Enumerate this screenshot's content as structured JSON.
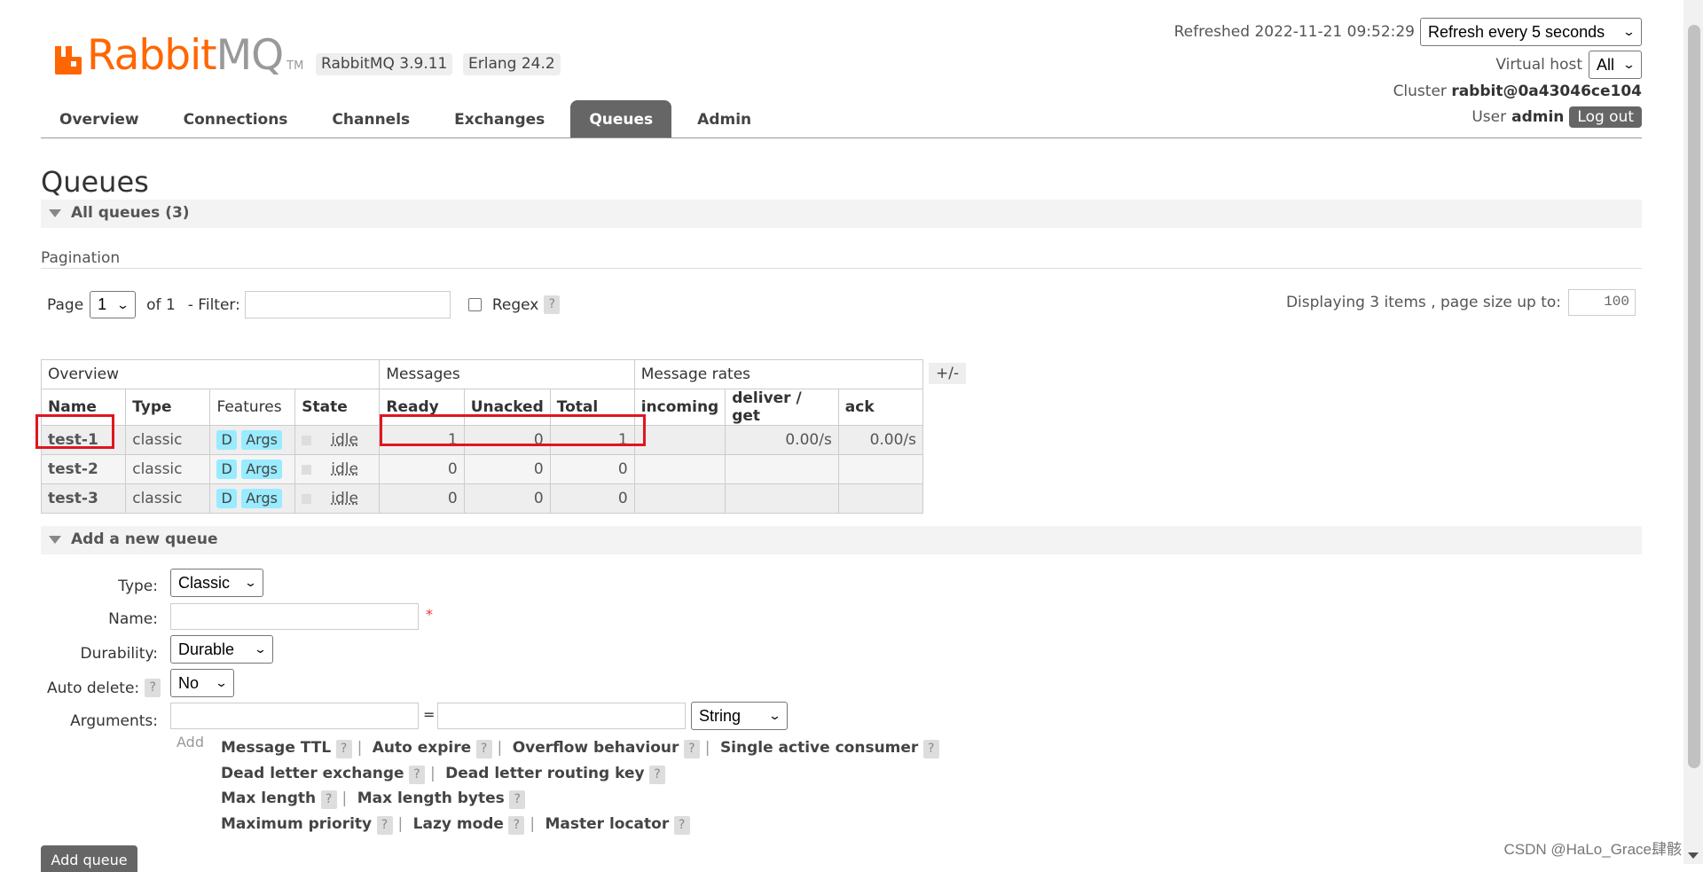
{
  "app": {
    "logo_text_rabbit": "Rabbit",
    "logo_text_mq": "MQ",
    "logo_tm": "TM",
    "version": "RabbitMQ 3.9.11",
    "erlang": "Erlang 24.2"
  },
  "header": {
    "refreshed": "Refreshed 2022-11-21 09:52:29",
    "refresh_select": "Refresh every 5 seconds",
    "vhost_label": "Virtual host",
    "vhost_select": "All",
    "cluster_label": "Cluster",
    "cluster_value": "rabbit@0a43046ce104",
    "user_label": "User",
    "user_value": "admin",
    "logout": "Log out"
  },
  "nav": [
    "Overview",
    "Connections",
    "Channels",
    "Exchanges",
    "Queues",
    "Admin"
  ],
  "page_title": "Queues",
  "all_queues": "All queues (3)",
  "pagination": {
    "label": "Pagination",
    "page_label": "Page",
    "page_value": "1",
    "of_label": "of 1",
    "filter_label": "- Filter:",
    "regex_label": "Regex",
    "help": "?",
    "displaying": "Displaying 3 items , page size up to:",
    "page_size": "100"
  },
  "table": {
    "group_overview": "Overview",
    "group_messages": "Messages",
    "group_rates": "Message rates",
    "toggle": "+/-",
    "headers": [
      "Name",
      "Type",
      "Features",
      "State",
      "Ready",
      "Unacked",
      "Total",
      "incoming",
      "deliver / get",
      "ack"
    ],
    "rows": [
      {
        "name": "test-1",
        "type": "classic",
        "feat_d": "D",
        "feat_args": "Args",
        "state": "idle",
        "ready": "1",
        "unacked": "0",
        "total": "1",
        "incoming": "",
        "deliver": "0.00/s",
        "ack": "0.00/s"
      },
      {
        "name": "test-2",
        "type": "classic",
        "feat_d": "D",
        "feat_args": "Args",
        "state": "idle",
        "ready": "0",
        "unacked": "0",
        "total": "0",
        "incoming": "",
        "deliver": "",
        "ack": ""
      },
      {
        "name": "test-3",
        "type": "classic",
        "feat_d": "D",
        "feat_args": "Args",
        "state": "idle",
        "ready": "0",
        "unacked": "0",
        "total": "0",
        "incoming": "",
        "deliver": "",
        "ack": ""
      }
    ]
  },
  "add_queue": {
    "section_label": "Add a new queue",
    "type_label": "Type:",
    "type_value": "Classic",
    "name_label": "Name:",
    "required_mark": "*",
    "durability_label": "Durability:",
    "durability_value": "Durable",
    "auto_delete_label": "Auto delete:",
    "auto_delete_value": "No",
    "arguments_label": "Arguments:",
    "equals": "=",
    "arg_type_value": "String",
    "add_link": "Add",
    "options": [
      [
        "Message TTL",
        "Auto expire",
        "Overflow behaviour",
        "Single active consumer"
      ],
      [
        "Dead letter exchange",
        "Dead letter routing key"
      ],
      [
        "Max length",
        "Max length bytes"
      ],
      [
        "Maximum priority",
        "Lazy mode",
        "Master locator"
      ]
    ],
    "submit": "Add queue"
  },
  "watermark": "CSDN @HaLo_Grace肆骸",
  "colors": {
    "brand": "#ff6600",
    "nav_active": "#666666",
    "highlight": "#e0161f",
    "tag": "#99ebff"
  }
}
